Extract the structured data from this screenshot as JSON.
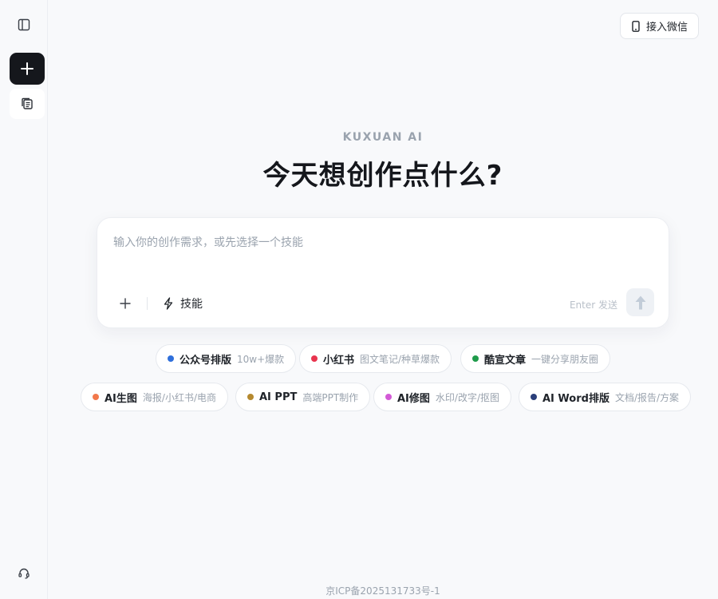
{
  "brand": "KUXUAN AI",
  "headline": "今天想创作点什么?",
  "header": {
    "wechat_label": "接入微信",
    "wechat_icon": "phone-icon"
  },
  "sidebar": {
    "toggle_icon": "sidebar-toggle-icon",
    "new_icon": "plus-icon",
    "docs_icon": "documents-icon",
    "support_icon": "headset-icon"
  },
  "composer": {
    "placeholder": "输入你的创作需求，或先选择一个技能",
    "value": "",
    "skill_label": "技能",
    "hint": "Enter 发送"
  },
  "chips": [
    {
      "title": "公众号排版",
      "sub": "10w+爆款",
      "color": "#2f6fdb"
    },
    {
      "title": "小红书",
      "sub": "图文笔记/种草爆款",
      "color": "#e8344e"
    },
    {
      "title": "酷宣文章",
      "sub": "一键分享朋友圈",
      "color": "#1f9b4b"
    },
    {
      "title": "AI生图",
      "sub": "海报/小红书/电商",
      "color": "#f2784b"
    },
    {
      "title": "AI PPT",
      "sub": "高端PPT制作",
      "color": "#b5892f"
    },
    {
      "title": "AI修图",
      "sub": "水印/改字/抠图",
      "color": "#d35ad6"
    },
    {
      "title": "AI Word排版",
      "sub": "文档/报告/方案",
      "color": "#2a3f7a"
    }
  ],
  "footer": "京ICP备2025131733号-1"
}
